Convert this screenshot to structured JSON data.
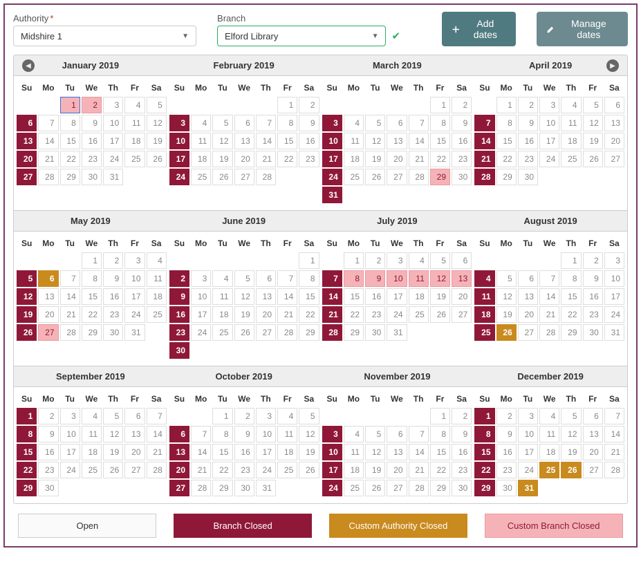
{
  "fields": {
    "authority_label": "Authority",
    "authority_value": "Midshire 1",
    "branch_label": "Branch",
    "branch_value": "Elford Library"
  },
  "buttons": {
    "add_dates": "Add dates",
    "manage_dates": "Manage dates"
  },
  "dow": [
    "Su",
    "Mo",
    "Tu",
    "We",
    "Th",
    "Fr",
    "Sa"
  ],
  "months": [
    {
      "title": "January 2019",
      "offset": 2,
      "ndays": 31,
      "closed": [
        6,
        13,
        20,
        27
      ],
      "cust_auth": [],
      "cust_branch": [
        2
      ],
      "cust_branch_outlined": [
        1
      ]
    },
    {
      "title": "February 2019",
      "offset": 5,
      "ndays": 28,
      "closed": [
        3,
        10,
        17,
        24
      ],
      "cust_auth": [],
      "cust_branch": [],
      "cust_branch_outlined": []
    },
    {
      "title": "March 2019",
      "offset": 5,
      "ndays": 31,
      "closed": [
        3,
        10,
        17,
        24,
        31
      ],
      "cust_auth": [],
      "cust_branch": [
        29
      ],
      "cust_branch_outlined": []
    },
    {
      "title": "April 2019",
      "offset": 1,
      "ndays": 30,
      "closed": [
        7,
        14,
        21,
        28
      ],
      "cust_auth": [],
      "cust_branch": [],
      "cust_branch_outlined": []
    },
    {
      "title": "May 2019",
      "offset": 3,
      "ndays": 31,
      "closed": [
        5,
        12,
        19,
        26
      ],
      "cust_auth": [
        6
      ],
      "cust_branch": [
        27
      ],
      "cust_branch_outlined": []
    },
    {
      "title": "June 2019",
      "offset": 6,
      "ndays": 30,
      "closed": [
        2,
        9,
        16,
        23,
        30
      ],
      "cust_auth": [],
      "cust_branch": [],
      "cust_branch_outlined": []
    },
    {
      "title": "July 2019",
      "offset": 1,
      "ndays": 31,
      "closed": [
        7,
        14,
        21,
        28
      ],
      "cust_auth": [],
      "cust_branch": [
        8,
        9,
        10,
        11,
        12,
        13
      ],
      "cust_branch_outlined": []
    },
    {
      "title": "August 2019",
      "offset": 4,
      "ndays": 31,
      "closed": [
        4,
        11,
        18,
        25
      ],
      "cust_auth": [
        26
      ],
      "cust_branch": [],
      "cust_branch_outlined": []
    },
    {
      "title": "September 2019",
      "offset": 0,
      "ndays": 30,
      "closed": [
        1,
        8,
        15,
        22,
        29
      ],
      "cust_auth": [],
      "cust_branch": [],
      "cust_branch_outlined": []
    },
    {
      "title": "October 2019",
      "offset": 2,
      "ndays": 31,
      "closed": [
        6,
        13,
        20,
        27
      ],
      "cust_auth": [],
      "cust_branch": [],
      "cust_branch_outlined": []
    },
    {
      "title": "November 2019",
      "offset": 5,
      "ndays": 30,
      "closed": [
        3,
        10,
        17,
        24
      ],
      "cust_auth": [],
      "cust_branch": [],
      "cust_branch_outlined": []
    },
    {
      "title": "December 2019",
      "offset": 0,
      "ndays": 31,
      "closed": [
        1,
        8,
        15,
        22,
        29
      ],
      "cust_auth": [
        25,
        26,
        31
      ],
      "cust_branch": [],
      "cust_branch_outlined": []
    }
  ],
  "legend": {
    "open": "Open",
    "branch_closed": "Branch Closed",
    "cust_auth": "Custom Authority Closed",
    "cust_branch": "Custom Branch Closed"
  }
}
